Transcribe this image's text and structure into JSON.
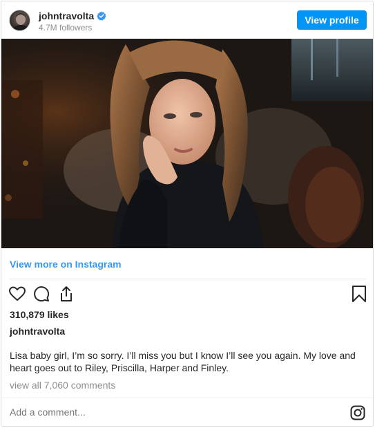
{
  "header": {
    "username": "johntravolta",
    "followers": "4.7M followers",
    "view_profile_label": "View profile"
  },
  "post": {
    "view_more_label": "View more on Instagram",
    "likes": "310,879 likes",
    "caption_username": "johntravolta",
    "caption_text": "Lisa baby girl, I’m so sorry. I’ll miss you but I know I’ll see you again. My love and heart goes out to Riley, Priscilla, Harper and Finley.",
    "view_all_comments": "view all 7,060 comments"
  },
  "comment": {
    "placeholder": "Add a comment..."
  },
  "colors": {
    "accent_blue": "#0095f6",
    "link_blue": "#3897f0",
    "muted_text": "#8e8e8e"
  },
  "icons": [
    "verified-badge-icon",
    "heart-icon",
    "comment-icon",
    "share-icon",
    "bookmark-icon",
    "instagram-icon"
  ]
}
